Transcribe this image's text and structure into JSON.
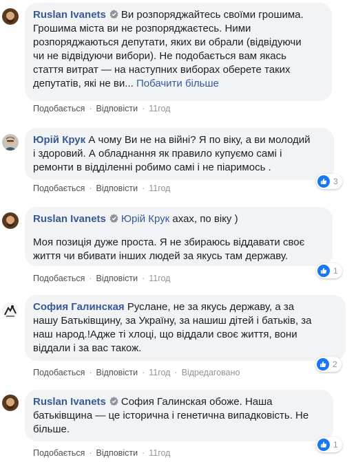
{
  "comments": [
    {
      "author": "Ruslan Ivanets",
      "verified": true,
      "text_lines": [
        "Ви розпоряджайтесь своїми грошима.",
        "Грошима міста ви не розпоряджаєтесь. Ними",
        "розпоряджаються депутати, яких ви обрали (відвідуючи",
        "чи не відвідуючи вибори). Не подобається вам якась",
        "стаття витрат — на наступних виборах оберете таких",
        "депутатів, які не ви..."
      ],
      "see_more": "Побачити більше",
      "like": "Подобається",
      "reply": "Відповісти",
      "time": "11год"
    },
    {
      "author": "Юрій Крук",
      "text_lines": [
        "А чому Ви не на війні? Я по віку, а ви молодий",
        "і здоровий. А обладнання як правило купуємо самі і",
        "ремонти в відділенні робимо самі і не піаримось ."
      ],
      "like": "Подобається",
      "reply": "Відповісти",
      "time": "11год",
      "reaction_count": "3"
    },
    {
      "author": "Ruslan Ivanets",
      "verified": true,
      "mention": "Юрій Крук",
      "text_first": "ахах, по віку )",
      "para_lines": [
        "Моя позиція дуже проста. Я не збираюсь віддавати своє",
        "життя чи вбивати інших людей за якусь там державу."
      ],
      "like": "Подобається",
      "reply": "Відповісти",
      "time": "11год",
      "reaction_count": "1"
    },
    {
      "author": "София Галинская",
      "text_lines": [
        "Руслане, не за якусь державу, а за",
        "нашу Батьківщину, за Україну, за нашиш дітей і батьків, за",
        "наш народ.!Адже ті хлоці, що віддали своє життя, вони",
        "віддали і за вас також."
      ],
      "like": "Подобається",
      "reply": "Відповісти",
      "time": "11год",
      "edited": "Відредаговано",
      "reaction_count": "2"
    },
    {
      "author": "Ruslan Ivanets",
      "verified": true,
      "text_lines": [
        "София Галинская обоже. Наша",
        "батьківщина — це історична і генетична випадковість. Не",
        "більше."
      ],
      "like": "Подобається",
      "reply": "Відповісти",
      "time": "11год",
      "reaction_count": "1"
    }
  ],
  "colors": {
    "link": "#385898",
    "bubble": "#f2f3f5",
    "meta": "#90949c",
    "like_blue": "#1877f2"
  },
  "icons": {
    "verified": "verified-badge-icon",
    "like": "thumbs-up-icon"
  }
}
